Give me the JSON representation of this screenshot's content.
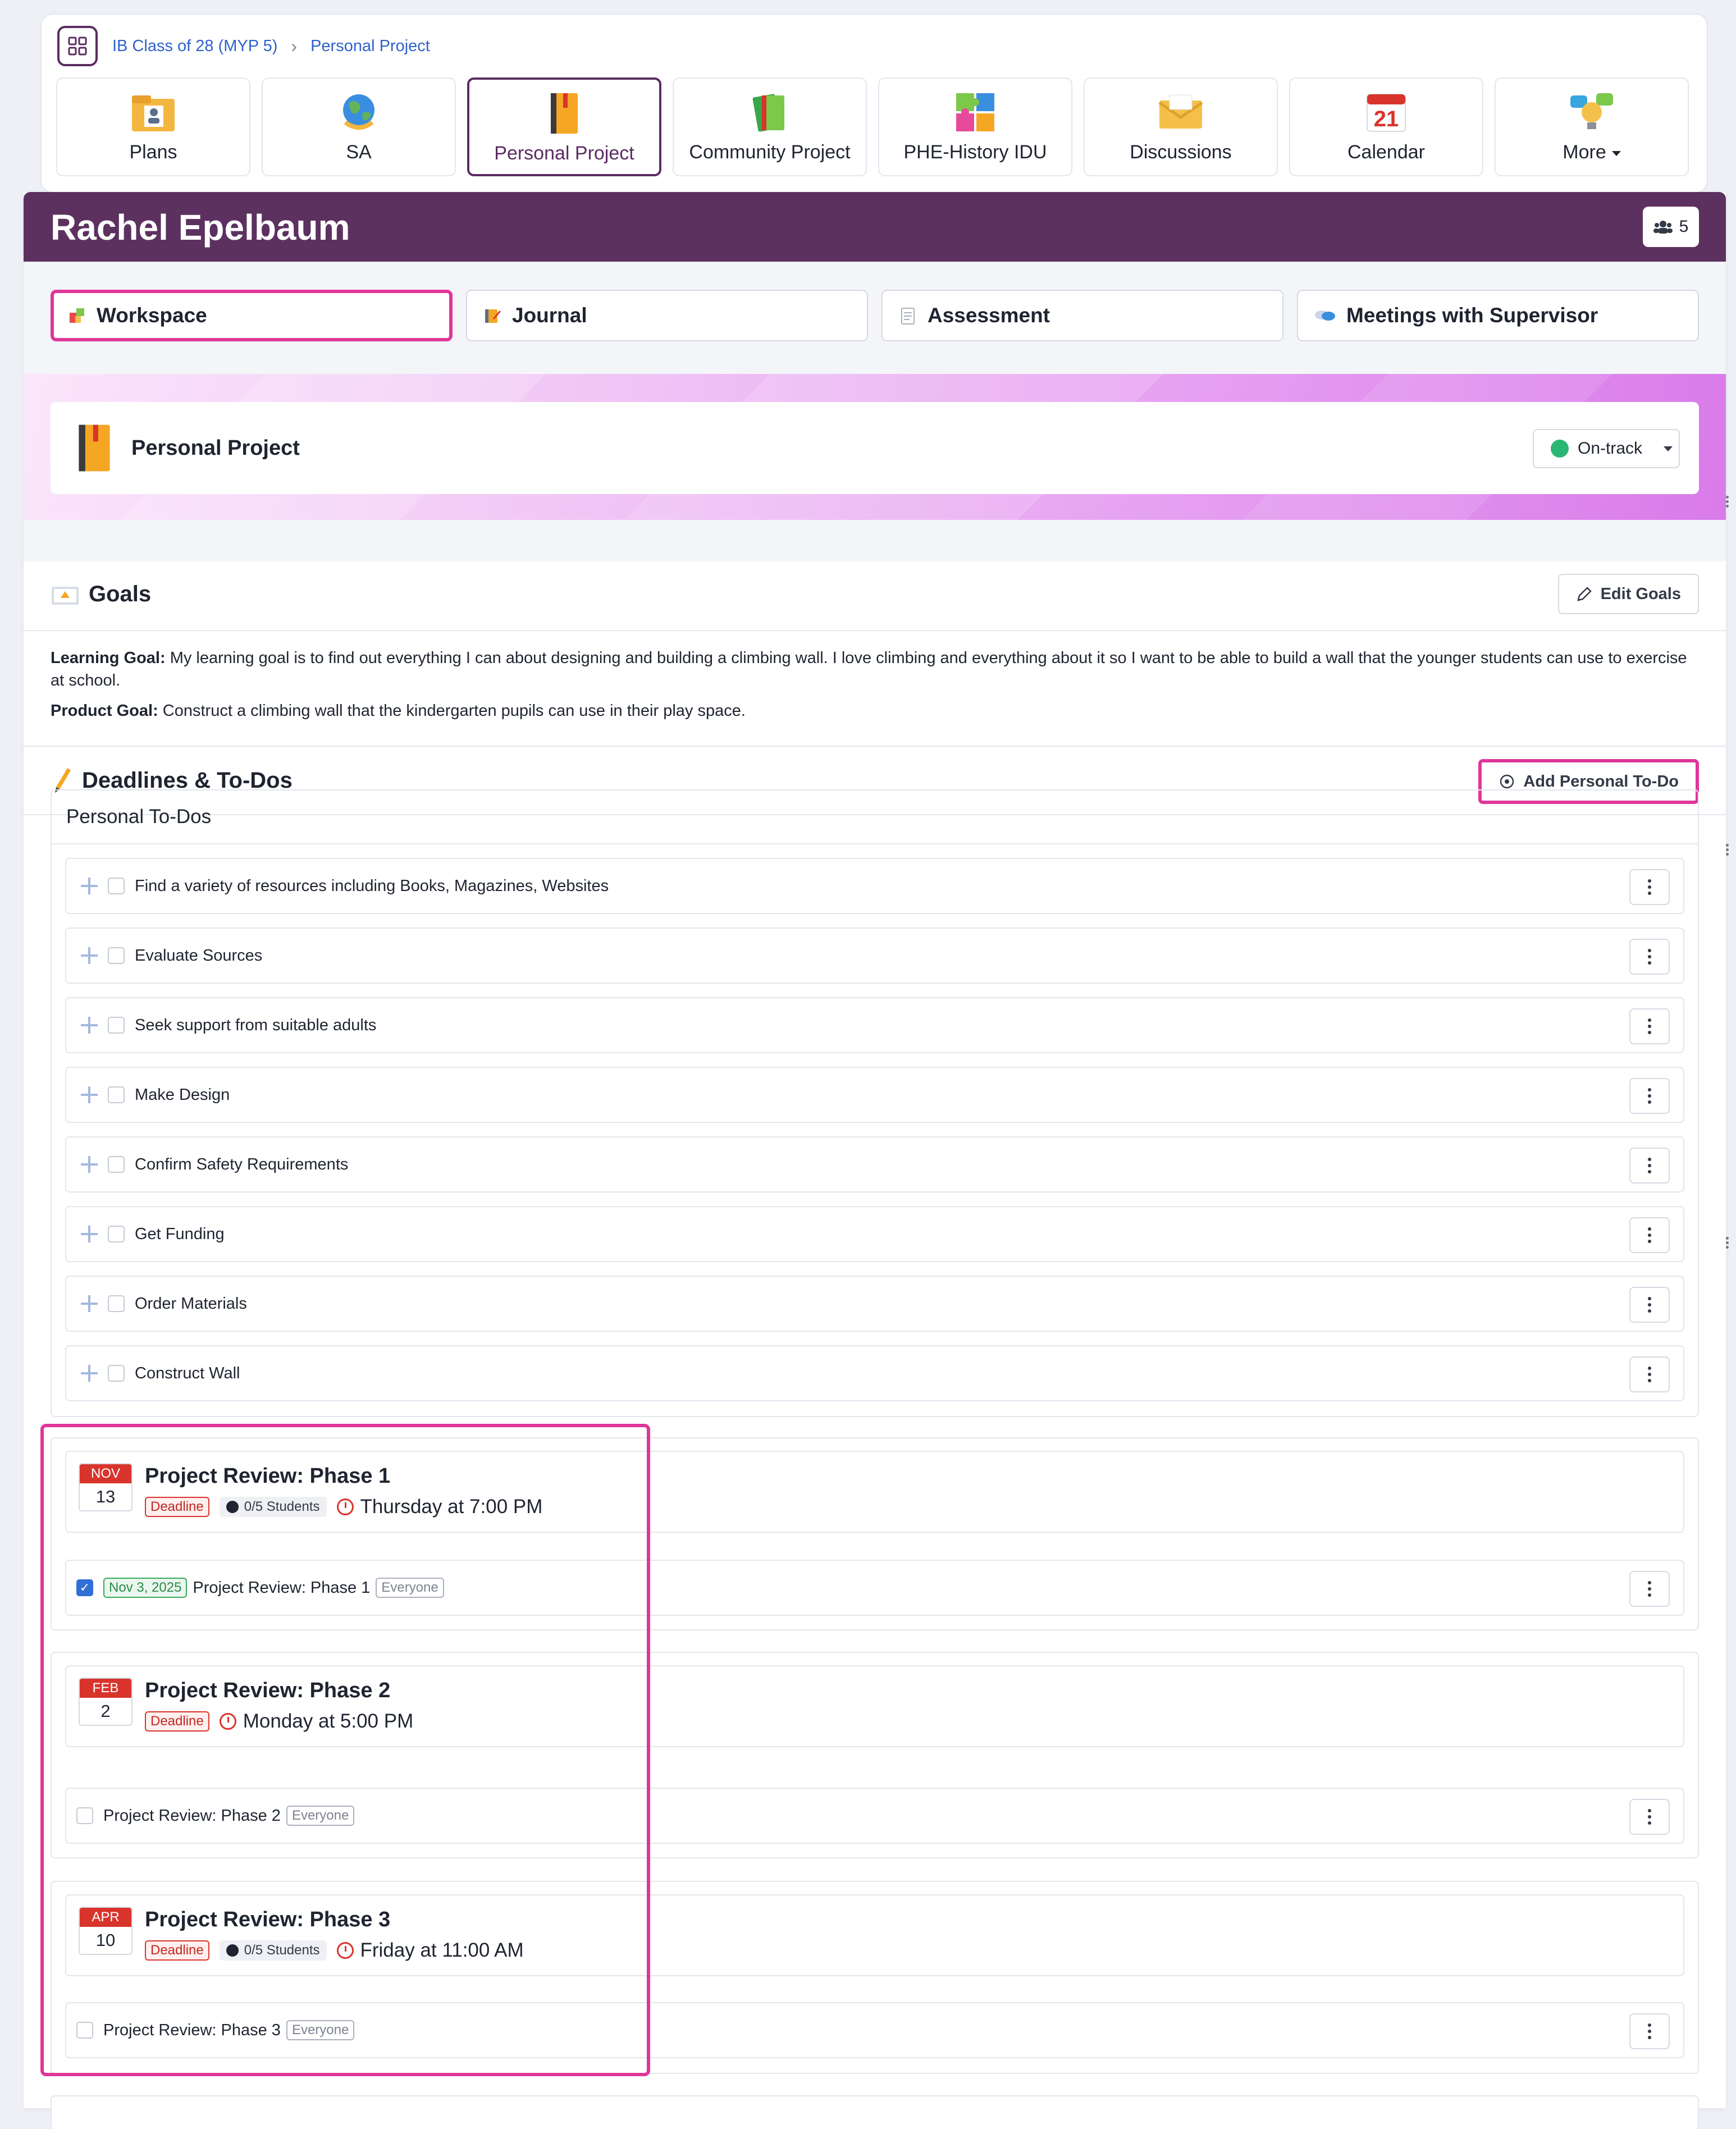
{
  "breadcrumb": {
    "class": "IB Class of 28 (MYP 5)",
    "current": "Personal Project"
  },
  "nav_tabs": [
    {
      "label": "Plans",
      "icon": "plans-icon"
    },
    {
      "label": "SA",
      "icon": "globe-icon"
    },
    {
      "label": "Personal Project",
      "icon": "notebook-icon",
      "active": true
    },
    {
      "label": "Community Project",
      "icon": "books-icon"
    },
    {
      "label": "PHE-History IDU",
      "icon": "puzzle-icon"
    },
    {
      "label": "Discussions",
      "icon": "envelope-icon"
    },
    {
      "label": "Calendar",
      "icon": "calendar-icon",
      "calendar_day": "21"
    },
    {
      "label": "More",
      "icon": "bulb-icon"
    }
  ],
  "student": {
    "name": "Rachel Epelbaum",
    "member_count": "5"
  },
  "sub_tabs": [
    {
      "label": "Workspace",
      "active": true
    },
    {
      "label": "Journal"
    },
    {
      "label": "Assessment"
    },
    {
      "label": "Meetings with Supervisor"
    }
  ],
  "project": {
    "title": "Personal Project",
    "status": "On-track",
    "status_color": "#2bb673"
  },
  "goals": {
    "title": "Goals",
    "edit_label": "Edit Goals",
    "learning_label": "Learning Goal:",
    "learning_text": "My learning goal is to find out everything I can about designing and building a climbing wall. I love climbing and everything about it so I want to be able to build a wall that the younger students can use to exercise at school.",
    "product_label": "Product Goal:",
    "product_text": "Construct a climbing wall that the kindergarten pupils can use in their play space."
  },
  "deadlines": {
    "title": "Deadlines & To-Dos",
    "add_label": "Add Personal To-Do"
  },
  "personal_todos": {
    "header": "Personal To-Dos",
    "items": [
      "Find a variety of resources including Books, Magazines, Websites",
      "Evaluate Sources",
      "Seek support from suitable adults",
      "Make Design",
      "Confirm Safety Requirements",
      "Get Funding",
      "Order Materials",
      "Construct Wall"
    ]
  },
  "phases": [
    {
      "month": "NOV",
      "day": "13",
      "title": "Project Review: Phase 1",
      "deadline": "Deadline",
      "students": "0/5 Students",
      "when": "Thursday at 7:00 PM",
      "task": {
        "checked": true,
        "date": "Nov 3, 2025",
        "label": "Project Review: Phase 1",
        "audience": "Everyone"
      }
    },
    {
      "month": "FEB",
      "day": "2",
      "title": "Project Review: Phase 2",
      "deadline": "Deadline",
      "when": "Monday at 5:00 PM",
      "task": {
        "checked": false,
        "label": "Project Review: Phase 2",
        "audience": "Everyone"
      }
    },
    {
      "month": "APR",
      "day": "10",
      "title": "Project Review: Phase 3",
      "deadline": "Deadline",
      "students": "0/5 Students",
      "when": "Friday at 11:00 AM",
      "task": {
        "checked": false,
        "label": "Project Review: Phase 3",
        "audience": "Everyone"
      }
    }
  ],
  "colors": {
    "brand": "#5c3160",
    "highlight": "#e0369a",
    "accent_link": "#2f62c9"
  }
}
